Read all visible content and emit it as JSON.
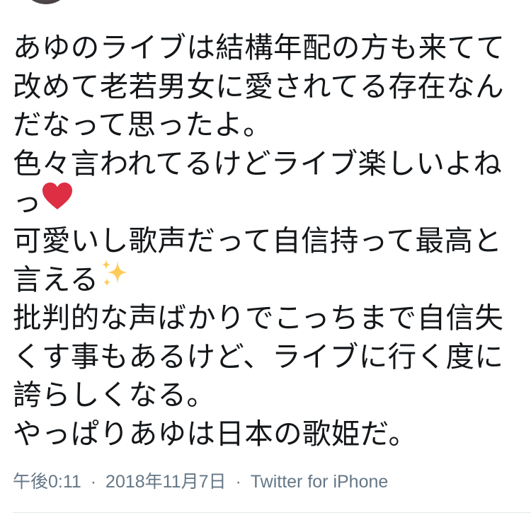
{
  "tweet": {
    "lines": [
      "あゆのライブは結構年配の方も来てて",
      "改めて老若男女に愛されてる存在なん",
      "だなって思ったよ。",
      "色々言われてるけどライブ楽しいよね",
      "っ",
      "可愛いし歌声だって自信持って最高と",
      "言える",
      "批判的な声ばかりでこっちまで自信失",
      "くす事もあるけど、ライブに行く度に",
      "誇らしくなる。",
      "やっぱりあゆは日本の歌姫だ。"
    ],
    "emojis": {
      "heart": {
        "icon": "red-heart-icon",
        "color": "#dd2e44"
      },
      "sparkles": {
        "icon": "sparkles-icon",
        "color": "#fdcb58"
      }
    }
  },
  "meta": {
    "time": "午後0:11",
    "separator": "·",
    "date": "2018年11月7日",
    "source": "Twitter for iPhone"
  },
  "colors": {
    "text": "#14171a",
    "meta_text": "#657786",
    "divider": "#e1e8ed"
  }
}
